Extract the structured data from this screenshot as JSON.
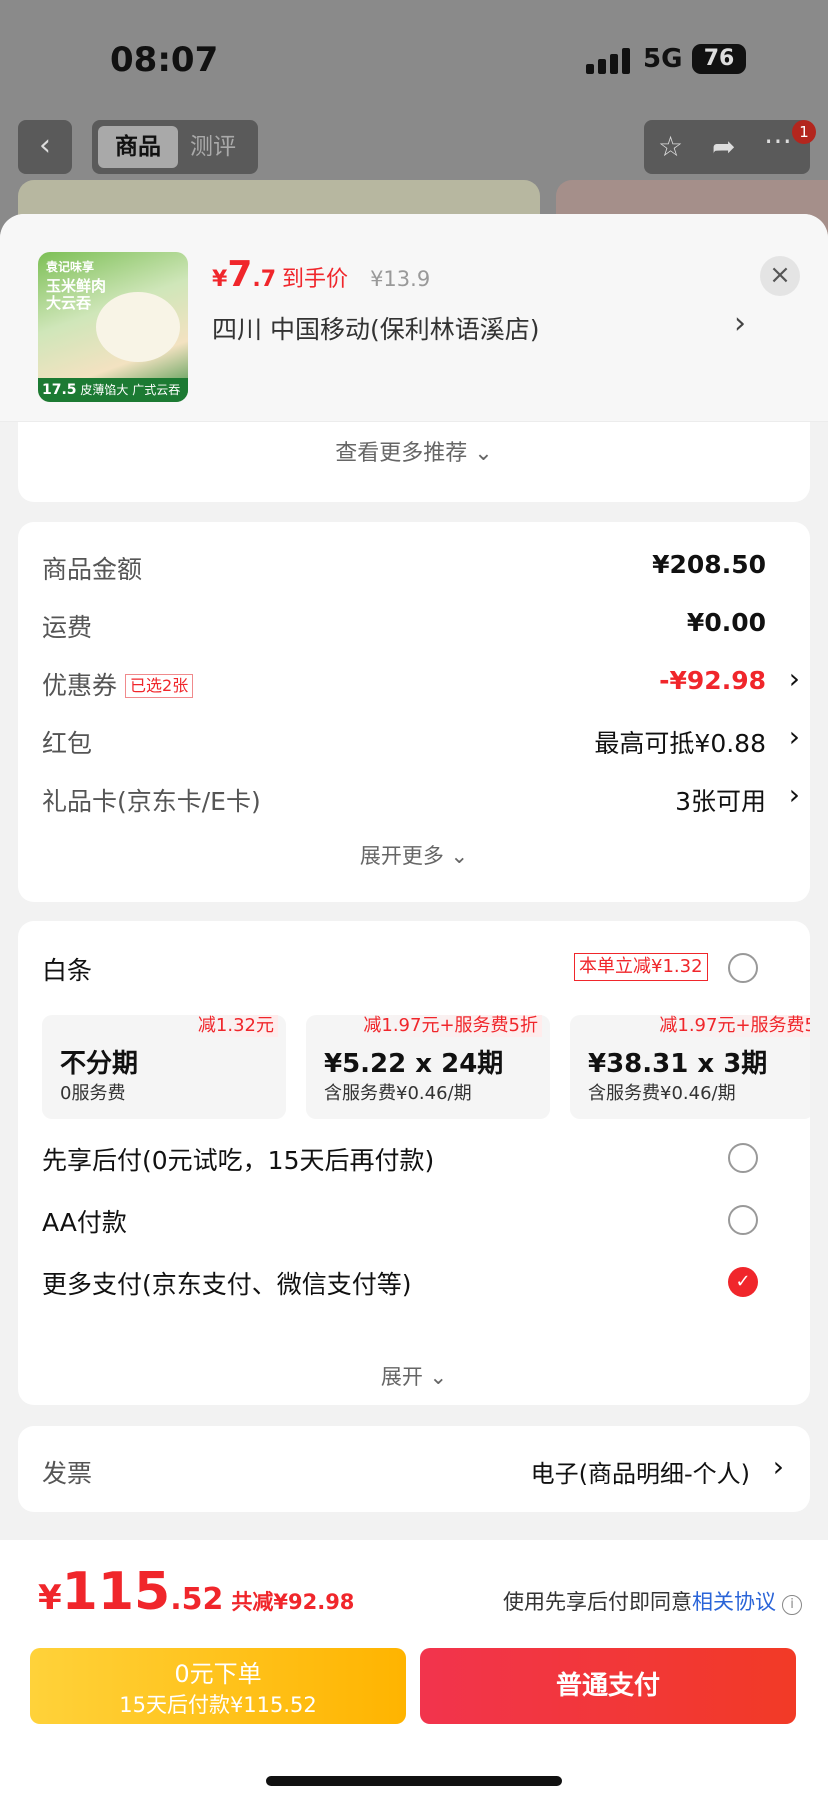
{
  "status": {
    "time": "08:07",
    "network": "5G",
    "battery": "76"
  },
  "nav": {
    "tab_active": "商品",
    "tab_inactive": "测评",
    "badge": "1"
  },
  "product": {
    "thumb_brand": "袁记味享",
    "thumb_headline": "玉米鲜肉大云吞",
    "thumb_price": "17.5",
    "thumb_tagline": "皮薄馅大 广式云吞",
    "price_symbol": "¥",
    "price_int": "7",
    "price_dec": ".7",
    "price_label": "到手价",
    "original_price": "¥13.9",
    "store": "四川  中国移动(保利林语溪店)"
  },
  "more_recommend": "查看更多推荐",
  "fees": {
    "goods_amount": {
      "label": "商品金额",
      "value": "¥208.50"
    },
    "shipping": {
      "label": "运费",
      "value": "¥0.00"
    },
    "coupon": {
      "label": "优惠券",
      "tag": "已选2张",
      "value": "-¥92.98"
    },
    "red_packet": {
      "label": "红包",
      "value": "最高可抵¥0.88"
    },
    "gift_card": {
      "label": "礼品卡(京东卡/E卡)",
      "value": "3张可用"
    },
    "expand_label": "展开更多"
  },
  "payment": {
    "baitiao_label": "白条",
    "baitiao_promo": "本单立减¥1.32",
    "plans": [
      {
        "discount": "减1.32元",
        "main": "不分期",
        "sub": "0服务费"
      },
      {
        "discount": "减1.97元+服务费5折",
        "main": "¥5.22 x 24期",
        "sub": "含服务费¥0.46/期"
      },
      {
        "discount": "减1.97元+服务费5",
        "main": "¥38.31 x 3期",
        "sub": "含服务费¥0.46/期"
      }
    ],
    "bnpl_option": "先享后付(0元试吃，15天后再付款)",
    "aa_option": "AA付款",
    "more_option": "更多支付(京东支付、微信支付等)",
    "expand_label": "展开"
  },
  "invoice": {
    "label": "发票",
    "value": "电子(商品明细-个人)"
  },
  "bottom": {
    "currency": "¥",
    "total_int": "115",
    "total_dec": ".52",
    "saved": "共减¥92.98",
    "agreement_prefix": "使用先享后付即同意",
    "agreement_link": "相关协议",
    "bnpl_btn_line1": "0元下单",
    "bnpl_btn_line2": "15天后付款¥115.52",
    "pay_btn": "普通支付"
  },
  "colors": {
    "accent": "#f0262b",
    "bnpl": "#ffc21a",
    "link": "#2a64d8"
  }
}
